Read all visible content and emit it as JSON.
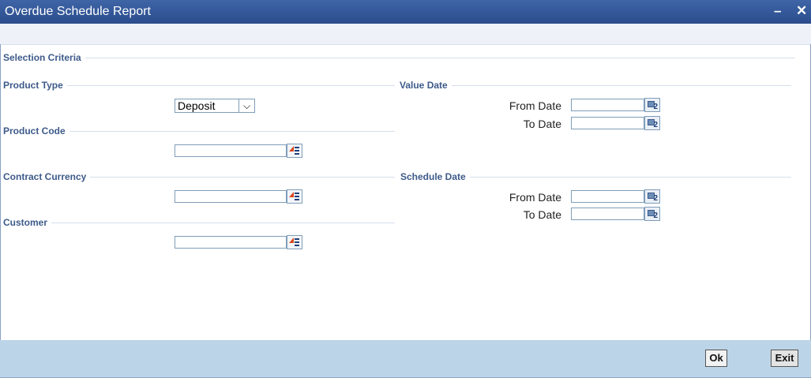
{
  "window": {
    "title": "Overdue Schedule Report",
    "minimize": "–",
    "close": "✕"
  },
  "sections": {
    "selection_criteria": "Selection Criteria",
    "product_type": "Product Type",
    "product_code": "Product Code",
    "contract_currency": "Contract Currency",
    "customer": "Customer",
    "value_date": "Value Date",
    "schedule_date": "Schedule Date"
  },
  "product_type": {
    "selected": "Deposit",
    "dropdown_glyph": "⌵"
  },
  "fields": {
    "product_code": "",
    "contract_currency": "",
    "customer": ""
  },
  "value_date": {
    "from_label": "From Date",
    "to_label": "To Date",
    "from": "",
    "to": ""
  },
  "schedule_date": {
    "from_label": "From Date",
    "to_label": "To Date",
    "from": "",
    "to": ""
  },
  "calendar_icon_number": "2",
  "buttons": {
    "ok": "Ok",
    "exit": "Exit"
  }
}
